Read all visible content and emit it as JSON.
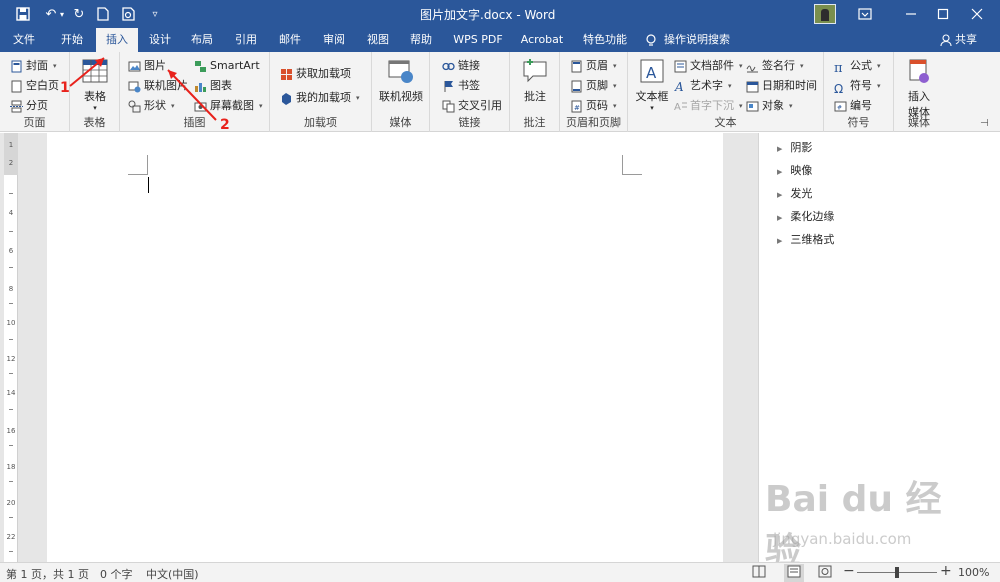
{
  "title_bar": {
    "document_title": "图片加文字.docx",
    "separator": "-",
    "app_name": "Word",
    "window_buttons": [
      "ribbon-display-options-icon",
      "minimize-icon",
      "maximize-icon",
      "close-icon"
    ]
  },
  "quick_access": [
    "save-icon",
    "undo-icon",
    "redo-icon",
    "new-document-icon",
    "print-preview-icon",
    "customize-icon"
  ],
  "tabs": [
    {
      "label": "文件"
    },
    {
      "label": "开始"
    },
    {
      "label": "插入",
      "active": true
    },
    {
      "label": "设计"
    },
    {
      "label": "布局"
    },
    {
      "label": "引用"
    },
    {
      "label": "邮件"
    },
    {
      "label": "审阅"
    },
    {
      "label": "视图"
    },
    {
      "label": "帮助"
    },
    {
      "label": "WPS PDF"
    },
    {
      "label": "Acrobat"
    },
    {
      "label": "特色功能"
    },
    {
      "label": "操作说明搜索"
    },
    {
      "label": "共享"
    }
  ],
  "ribbon": {
    "pages": {
      "label": "页面",
      "items": [
        "封面",
        "空白页",
        "分页"
      ]
    },
    "table": {
      "label": "表格",
      "button": "表格"
    },
    "illustrations": {
      "label": "插图",
      "items": [
        "图片",
        "联机图片",
        "形状",
        "SmartArt",
        "图表",
        "屏幕截图"
      ]
    },
    "addins": {
      "label": "加载项",
      "items": [
        "获取加载项",
        "我的加载项"
      ]
    },
    "media": {
      "label": "媒体",
      "button": "联机视频"
    },
    "links": {
      "label": "链接",
      "items": [
        "链接",
        "书签",
        "交叉引用"
      ]
    },
    "comments": {
      "label": "批注",
      "button": "批注"
    },
    "header_footer": {
      "label": "页眉和页脚",
      "items": [
        "页眉",
        "页脚",
        "页码"
      ]
    },
    "text": {
      "label": "文本",
      "button": "文本框",
      "items": [
        "文档部件",
        "艺术字",
        "首字下沉",
        "签名行",
        "日期和时间",
        "对象"
      ]
    },
    "symbols": {
      "label": "符号",
      "items": [
        "公式",
        "符号",
        "编号"
      ]
    },
    "media2": {
      "label": "媒体",
      "button_line1": "插入",
      "button_line2": "媒体"
    }
  },
  "annotations": [
    "1",
    "2"
  ],
  "annotation_color": "#e8221c",
  "ruler_labels": [
    "1",
    "2",
    "4",
    "6",
    "8",
    "10",
    "12",
    "14",
    "16",
    "18",
    "20",
    "22"
  ],
  "format_pane": {
    "items": [
      "阴影",
      "映像",
      "发光",
      "柔化边缘",
      "三维格式"
    ]
  },
  "status_bar": {
    "page": "第 1 页，共 1 页",
    "words": "0 个字",
    "language": "中文(中国)",
    "zoom": "100%"
  },
  "watermark": {
    "brand": "Bai du 经验",
    "url": "jingyan.baidu.com"
  },
  "colors": {
    "accent": "#2b579a",
    "ribbon_bg": "#f3f3f3",
    "canvas_bg": "#e6e6e6"
  }
}
